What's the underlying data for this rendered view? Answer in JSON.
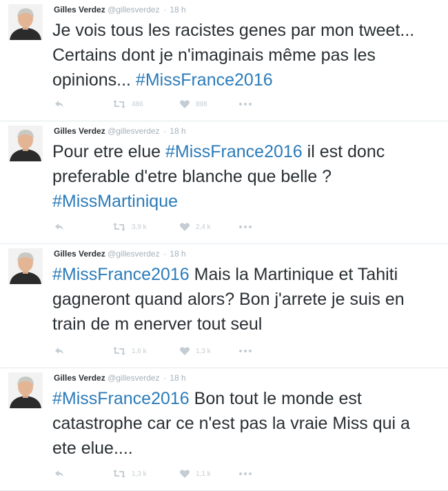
{
  "colors": {
    "text": "#292f33",
    "muted": "#a4b1bb",
    "hashtag": "#2b7bb9",
    "action": "#c4cdd3",
    "divider": "#e1e8ed"
  },
  "icons": {
    "reply": "reply-icon",
    "retweet": "retweet-icon",
    "like": "heart-icon",
    "more": "more-dots-icon"
  },
  "tweets": [
    {
      "name": "Gilles Verdez",
      "handle": "@gillesverdez",
      "sep": "·",
      "time": "18 h",
      "text_before": "Je vois tous les racistes genes par mon tweet... Certains dont je n'imaginais même pas les opinions... ",
      "hashtag1": "#MissFrance2016",
      "text_after": "",
      "retweets": "486",
      "likes": "898"
    },
    {
      "name": "Gilles Verdez",
      "handle": "@gillesverdez",
      "sep": "·",
      "time": "18 h",
      "text_before": "Pour etre elue ",
      "hashtag1": "#MissFrance2016",
      "text_after": " il est donc preferable d'etre blanche que belle ?\n",
      "hashtag2": "#MissMartinique",
      "retweets": "3,9 k",
      "likes": "2,4 k"
    },
    {
      "name": "Gilles Verdez",
      "handle": "@gillesverdez",
      "sep": "·",
      "time": "18 h",
      "text_before": "",
      "hashtag1": "#MissFrance2016",
      "text_after": " Mais la Martinique et Tahiti gagneront quand alors? Bon j'arrete je suis en train de m enerver tout seul",
      "retweets": "1,6 k",
      "likes": "1,3 k"
    },
    {
      "name": "Gilles Verdez",
      "handle": "@gillesverdez",
      "sep": "·",
      "time": "18 h",
      "text_before": "",
      "hashtag1": "#MissFrance2016",
      "text_after": " Bon tout le monde est catastrophe car ce n'est pas la vraie Miss qui a ete elue....",
      "retweets": "1,3 k",
      "likes": "1,1 k"
    }
  ]
}
